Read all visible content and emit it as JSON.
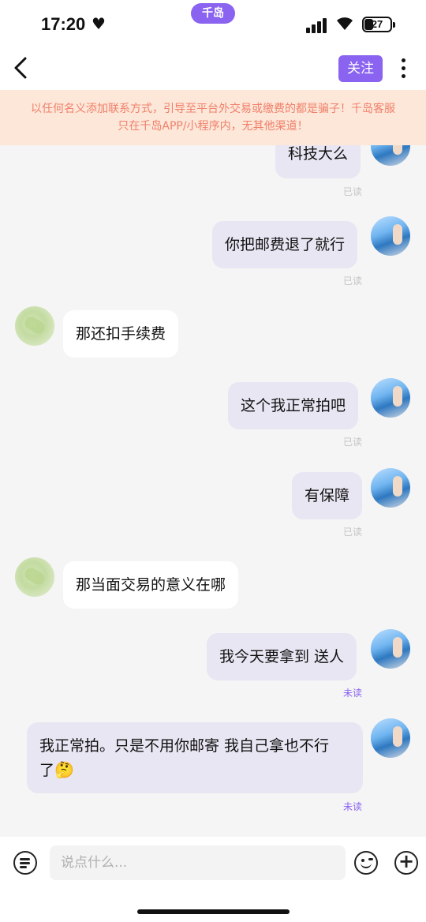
{
  "status_bar": {
    "time": "17:20",
    "heart": "♥",
    "island_label": "千岛",
    "wifi": "wifi-icon",
    "battery_level": "27"
  },
  "header": {
    "back": "‹",
    "follow_label": "关注",
    "more": "more-icon"
  },
  "warning_lines": [
    "以任何名义添加联系方式，引导至平台外交易或缴费的都是骗子！千岛客服",
    "只在千岛APP/小程序内，无其他渠道！"
  ],
  "messages": [
    {
      "sender": "me",
      "text": "科技大么",
      "status": "已读"
    },
    {
      "sender": "me",
      "text": "你把邮费退了就行",
      "status": "已读"
    },
    {
      "sender": "them",
      "text": "那还扣手续费"
    },
    {
      "sender": "me",
      "text": "这个我正常拍吧",
      "status": "已读"
    },
    {
      "sender": "me",
      "text": "有保障",
      "status": "已读"
    },
    {
      "sender": "them",
      "text": "那当面交易的意义在哪"
    },
    {
      "sender": "me",
      "text": "我今天要拿到 送人",
      "status": "未读"
    },
    {
      "sender": "me",
      "text_line1": "我正常拍。只是不用你邮寄  我自己拿也不行",
      "text_line2": "了",
      "emoji": "🤔",
      "status": "未读"
    }
  ],
  "input_bar": {
    "placeholder": "说点什么...",
    "menu_icon": "list-icon",
    "emoji_icon": "emoji-icon",
    "plus_icon": "+"
  },
  "colors": {
    "accent": "#8a63f0",
    "warning_bg": "#fde7d9",
    "warning_text": "#f0806a",
    "my_bubble": "#e9e6f3",
    "unread": "#8a63f0"
  }
}
